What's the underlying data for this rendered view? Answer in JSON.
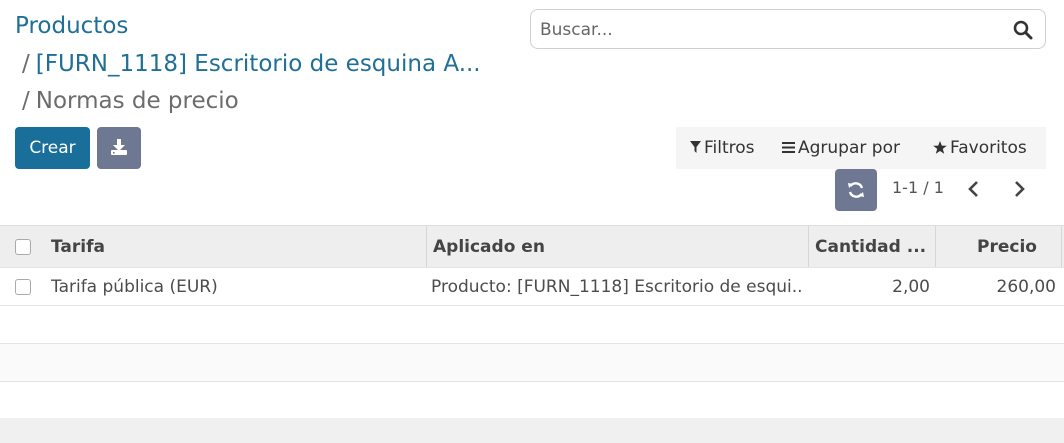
{
  "breadcrumb": {
    "root": "Productos",
    "separator": "/",
    "item1": "[FURN_1118] Escritorio de esquina A...",
    "item2": "Normas de precio"
  },
  "search": {
    "placeholder": "Buscar..."
  },
  "toolbar": {
    "create_label": "Crear",
    "filters_label": "Filtros",
    "groupby_label": "Agrupar por",
    "favorites_label": "Favoritos"
  },
  "pager": {
    "value": "1-1 / 1"
  },
  "table": {
    "columns": [
      "Tarifa",
      "Aplicado en",
      "Cantidad ...",
      "Precio"
    ],
    "rows": [
      {
        "tarifa": "Tarifa pública (EUR)",
        "aplicado": "Producto: [FURN_1118] Escritorio de esqui...",
        "cantidad": "2,00",
        "precio": "260,00"
      }
    ]
  },
  "colors": {
    "primary": "#1a6e9a",
    "secondary": "#6e7892",
    "link": "#1f6f97"
  }
}
